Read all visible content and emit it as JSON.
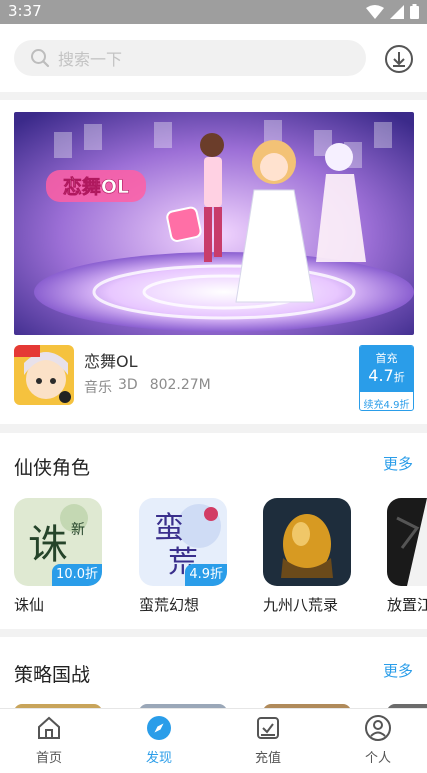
{
  "status": {
    "time": "3:37"
  },
  "search": {
    "placeholder": "搜索一下"
  },
  "featured": {
    "banner_logo": "恋舞OL",
    "title": "恋舞OL",
    "tags": [
      "音乐",
      "3D",
      "802.27M"
    ],
    "discount": {
      "line1": "首充",
      "value": "4.7",
      "unit": "折",
      "line2": "续充4.9折"
    }
  },
  "sections": [
    {
      "title": "仙侠角色",
      "more": "更多",
      "apps": [
        {
          "name": "诛仙",
          "badge": "10.0折",
          "icon": "zhuxian-icon"
        },
        {
          "name": "蛮荒幻想",
          "badge": "4.9折",
          "icon": "manhuang-icon"
        },
        {
          "name": "九州八荒录",
          "badge": "",
          "icon": "golden-egg-icon"
        },
        {
          "name": "放置江",
          "badge": "",
          "icon": "fangzhi-icon"
        }
      ]
    },
    {
      "title": "策略国战",
      "more": "更多"
    }
  ],
  "tabs": [
    {
      "label": "首页",
      "icon": "home-icon"
    },
    {
      "label": "发现",
      "icon": "compass-icon"
    },
    {
      "label": "充值",
      "icon": "recharge-icon"
    },
    {
      "label": "个人",
      "icon": "user-icon"
    }
  ],
  "colors": {
    "accent": "#2a9de9",
    "statusbar": "#9e9e9e"
  }
}
